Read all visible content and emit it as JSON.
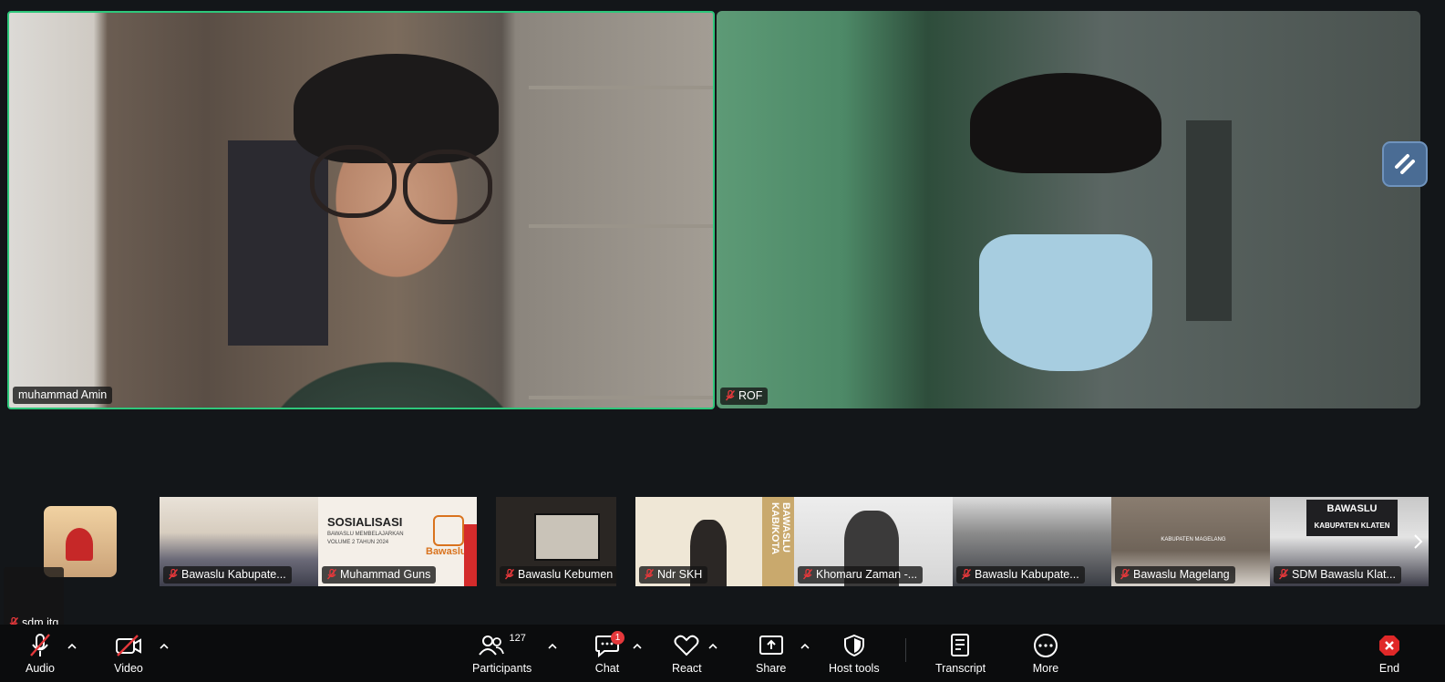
{
  "main_tiles": [
    {
      "name": "muhammad Amin",
      "muted": false,
      "active_speaker": true
    },
    {
      "name": "ROF",
      "muted": true,
      "active_speaker": false
    }
  ],
  "gallery": [
    {
      "name": "sdm jtg",
      "muted": true
    },
    {
      "name": "Bawaslu Kabupate...",
      "muted": true
    },
    {
      "name": "Muhammad Guns",
      "muted": true
    },
    {
      "name": "Bawaslu Kebumen",
      "muted": true
    },
    {
      "name": "Ndr SKH",
      "muted": true
    },
    {
      "name": "Khomaru Zaman -...",
      "muted": true
    },
    {
      "name": "Bawaslu Kabupate...",
      "muted": true
    },
    {
      "name": "Bawaslu Magelang",
      "muted": true
    },
    {
      "name": "SDM Bawaslu Klat...",
      "muted": true
    }
  ],
  "thumb_text": {
    "sosialisasi": "SOSIALISASI",
    "bawaslu_membelajarkan": "BAWASLU MEMBELAJARKAN",
    "volume": "VOLUME 2 TAHUN 2024",
    "bawaslu": "Bawaslu",
    "bawaslu_kabkota": "BAWASLU KAB/KOTA",
    "bawaslu_upper": "BAWASLU",
    "kabupaten_klaten": "KABUPATEN KLATEN",
    "kabupaten_magelang": "KABUPATEN MAGELANG"
  },
  "toolbar": {
    "audio": "Audio",
    "video": "Video",
    "participants": "Participants",
    "participants_count": "127",
    "chat": "Chat",
    "chat_badge": "1",
    "react": "React",
    "share": "Share",
    "host_tools": "Host tools",
    "transcript": "Transcript",
    "more": "More",
    "end": "End"
  },
  "colors": {
    "active_speaker_border": "#2ec77b",
    "muted_red": "#e5383b",
    "toolbar_bg": "#0b0c0d",
    "end_red": "#e02828"
  }
}
